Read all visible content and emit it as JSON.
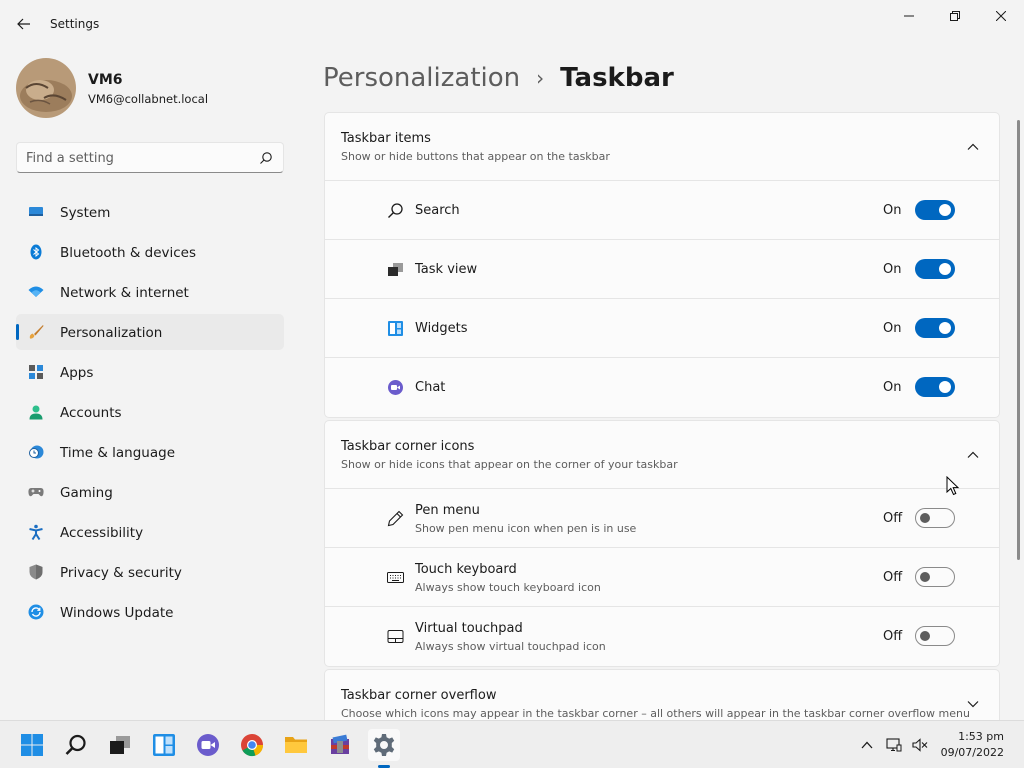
{
  "window": {
    "title": "Settings"
  },
  "profile": {
    "name": "VM6",
    "email": "VM6@collabnet.local"
  },
  "search": {
    "placeholder": "Find a setting"
  },
  "sidebar": {
    "items": [
      {
        "label": "System",
        "icon": "monitor-icon"
      },
      {
        "label": "Bluetooth & devices",
        "icon": "bluetooth-icon"
      },
      {
        "label": "Network & internet",
        "icon": "wifi-icon"
      },
      {
        "label": "Personalization",
        "icon": "brush-icon",
        "active": true
      },
      {
        "label": "Apps",
        "icon": "apps-icon"
      },
      {
        "label": "Accounts",
        "icon": "person-icon"
      },
      {
        "label": "Time & language",
        "icon": "clock-globe-icon"
      },
      {
        "label": "Gaming",
        "icon": "gamepad-icon"
      },
      {
        "label": "Accessibility",
        "icon": "accessibility-icon"
      },
      {
        "label": "Privacy & security",
        "icon": "shield-icon"
      },
      {
        "label": "Windows Update",
        "icon": "update-icon"
      }
    ]
  },
  "breadcrumb": {
    "parent": "Personalization",
    "separator": "›",
    "current": "Taskbar"
  },
  "sections": {
    "taskbar_items": {
      "title": "Taskbar items",
      "subtitle": "Show or hide buttons that appear on the taskbar",
      "rows": [
        {
          "label": "Search",
          "state": "On",
          "on": true
        },
        {
          "label": "Task view",
          "state": "On",
          "on": true
        },
        {
          "label": "Widgets",
          "state": "On",
          "on": true
        },
        {
          "label": "Chat",
          "state": "On",
          "on": true
        }
      ]
    },
    "corner_icons": {
      "title": "Taskbar corner icons",
      "subtitle": "Show or hide icons that appear on the corner of your taskbar",
      "rows": [
        {
          "label": "Pen menu",
          "sub": "Show pen menu icon when pen is in use",
          "state": "Off",
          "on": false
        },
        {
          "label": "Touch keyboard",
          "sub": "Always show touch keyboard icon",
          "state": "Off",
          "on": false
        },
        {
          "label": "Virtual touchpad",
          "sub": "Always show virtual touchpad icon",
          "state": "Off",
          "on": false
        }
      ]
    },
    "corner_overflow": {
      "title": "Taskbar corner overflow",
      "subtitle": "Choose which icons may appear in the taskbar corner – all others will appear in the taskbar corner overflow menu"
    }
  },
  "taskbar": {
    "time": "1:53 pm",
    "date": "09/07/2022"
  },
  "colors": {
    "accent": "#0067c0",
    "background": "#f3f3f3",
    "card": "#fbfbfb"
  }
}
